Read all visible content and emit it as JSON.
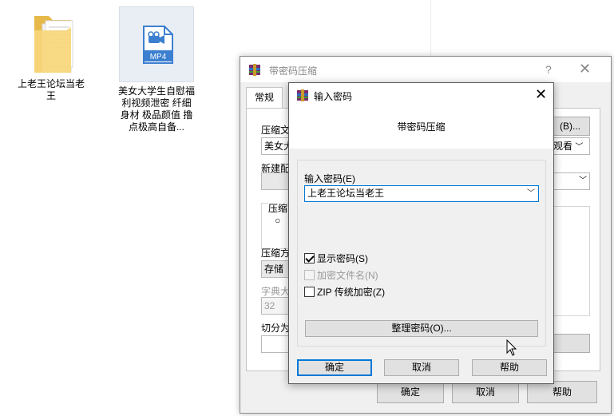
{
  "desktop": {
    "folder_label": "上老王论坛当老王",
    "mp4_label": "美女大学生自慰福利视频泄密 纤细身材 极品颜值 撸点极高自备...",
    "mp4_badge": "MP4"
  },
  "back_window": {
    "title": "带密码压缩",
    "help": "?",
    "tab_general": "常规",
    "archive_label": "压缩文",
    "archive_value": "美女大",
    "browse_label": "(B)...",
    "update_value": "观看",
    "profile_label": "新建配",
    "format_label": "压缩",
    "method_label": "压缩方",
    "method_value": "存储",
    "dict_label": "字典大",
    "dict_value": "32",
    "split_label": "切分为",
    "ok": "确定",
    "cancel": "取消",
    "help_btn": "帮助"
  },
  "dialog": {
    "title": "输入密码",
    "header": "带密码压缩",
    "password_label": "输入密码(E)",
    "password_value": "上老王论坛当老王",
    "show_password": {
      "label": "显示密码(S)",
      "checked": true
    },
    "encrypt_names": {
      "label": "加密文件名(N)",
      "checked": false,
      "disabled": true
    },
    "zip_legacy": {
      "label": "ZIP 传统加密(Z)",
      "checked": false
    },
    "organize_button": "整理密码(O)...",
    "ok": "确定",
    "cancel": "取消",
    "help": "帮助"
  },
  "colors": {
    "accent": "#0078d7",
    "button_face": "#e1e1e1",
    "dialog_bg": "#f0f0f0"
  }
}
